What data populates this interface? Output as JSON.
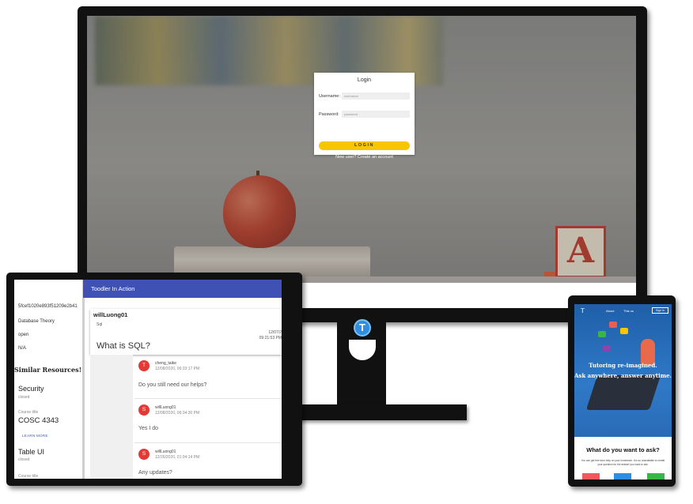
{
  "monitor": {
    "login": {
      "title": "Login",
      "username_label": "Username:",
      "username_placeholder": "username",
      "password_label": "Password:",
      "password_placeholder": "password",
      "login_button": "LOGIN",
      "signup_link": "New user? Create an account"
    },
    "block_letter": "A",
    "logo_letter": "T"
  },
  "laptop": {
    "header_title": "Toodler In Action",
    "sidebar": {
      "id": "5fcef1020e893f51209e2b41",
      "topic": "Database Theory",
      "status": "open",
      "extra": "N/A",
      "similar_heading": "Similar Resources!",
      "resources": [
        {
          "title": "Security",
          "status": "closed",
          "course_label": "Course title",
          "course_code": "COSC 4343",
          "action": "LEARN MORE"
        },
        {
          "title": "Table UI",
          "status": "closed",
          "course_label": "Course title"
        }
      ]
    },
    "question": {
      "user": "willLuong01",
      "tag": "Sql",
      "date": "12/07/2",
      "time": "09:21:53 PM",
      "text": "What is SQL?"
    },
    "replies": [
      {
        "avatar": "T",
        "name": "cheng_taike",
        "date": "12/08/2020, 06:33:17 PM",
        "text": "Do you still need our helps?"
      },
      {
        "avatar": "S",
        "name": "willLuong01",
        "date": "12/08/2020, 06:34:30 PM",
        "text": "Yes I do"
      },
      {
        "avatar": "S",
        "name": "willLuong01",
        "date": "12/26/2020, 01:04:14 PM",
        "text": "Any updates?"
      }
    ]
  },
  "phone": {
    "logo": "T",
    "nav": [
      "About",
      "This us"
    ],
    "signin": "Sign In",
    "headline1": "Tutoring re-imagined.",
    "headline2": "Ask anywhere, answer anytime.",
    "ask_heading": "What do you want to ask?",
    "ask_desc": "You can get free tutor help on your homework. It is so unavailable to create your question for the answer you want to ask."
  },
  "colors": {
    "header_blue": "#3f51b5",
    "login_yellow": "#f7c600",
    "avatar_red": "#e53935",
    "logo_blue": "#2f8ee0"
  }
}
